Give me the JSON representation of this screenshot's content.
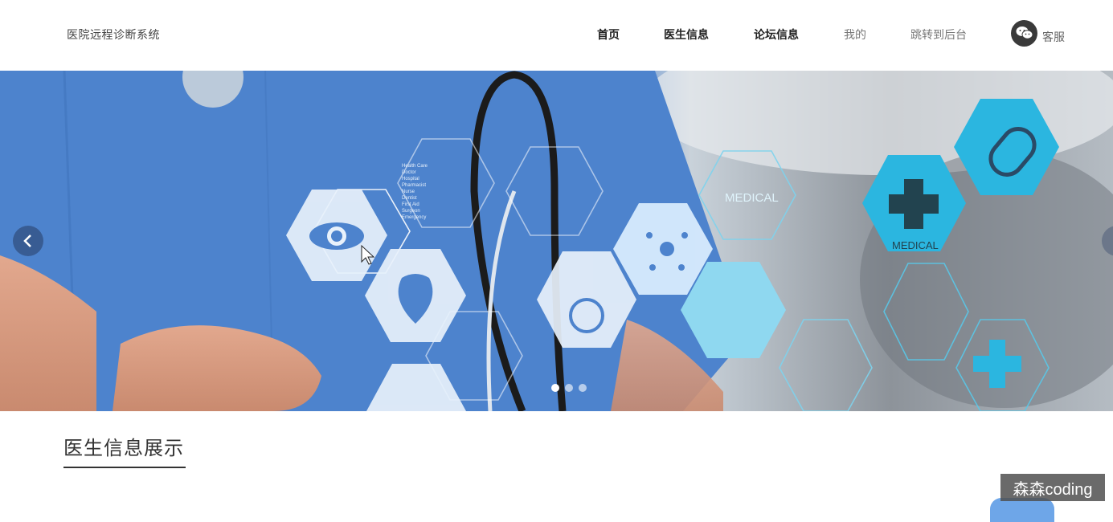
{
  "header": {
    "brand": "医院远程诊断系统",
    "nav": [
      {
        "label": "首页",
        "style": "bold"
      },
      {
        "label": "医生信息",
        "style": "bold"
      },
      {
        "label": "论坛信息",
        "style": "bold"
      },
      {
        "label": "我的",
        "style": "light"
      },
      {
        "label": "跳转到后台",
        "style": "light"
      }
    ],
    "service_label": "客服",
    "service_icon": "wechat-icon"
  },
  "banner": {
    "hex_labels": {
      "medical_1": "MEDICAL",
      "medical_2": "MEDICAL"
    },
    "hex_list_text": [
      "Health Care",
      "Doctor",
      "Hospital",
      "Pharmacist",
      "Nurse",
      "Dentist",
      "First Aid",
      "Surgeon",
      "Emergency"
    ],
    "slide_dots": 3,
    "active_dot": 0
  },
  "section": {
    "title": "医生信息展示"
  },
  "watermark": "森森coding",
  "colors": {
    "scrubs_blue": "#4f84cc",
    "hex_cyan": "#29b8e0",
    "accent_dark": "#333333"
  }
}
